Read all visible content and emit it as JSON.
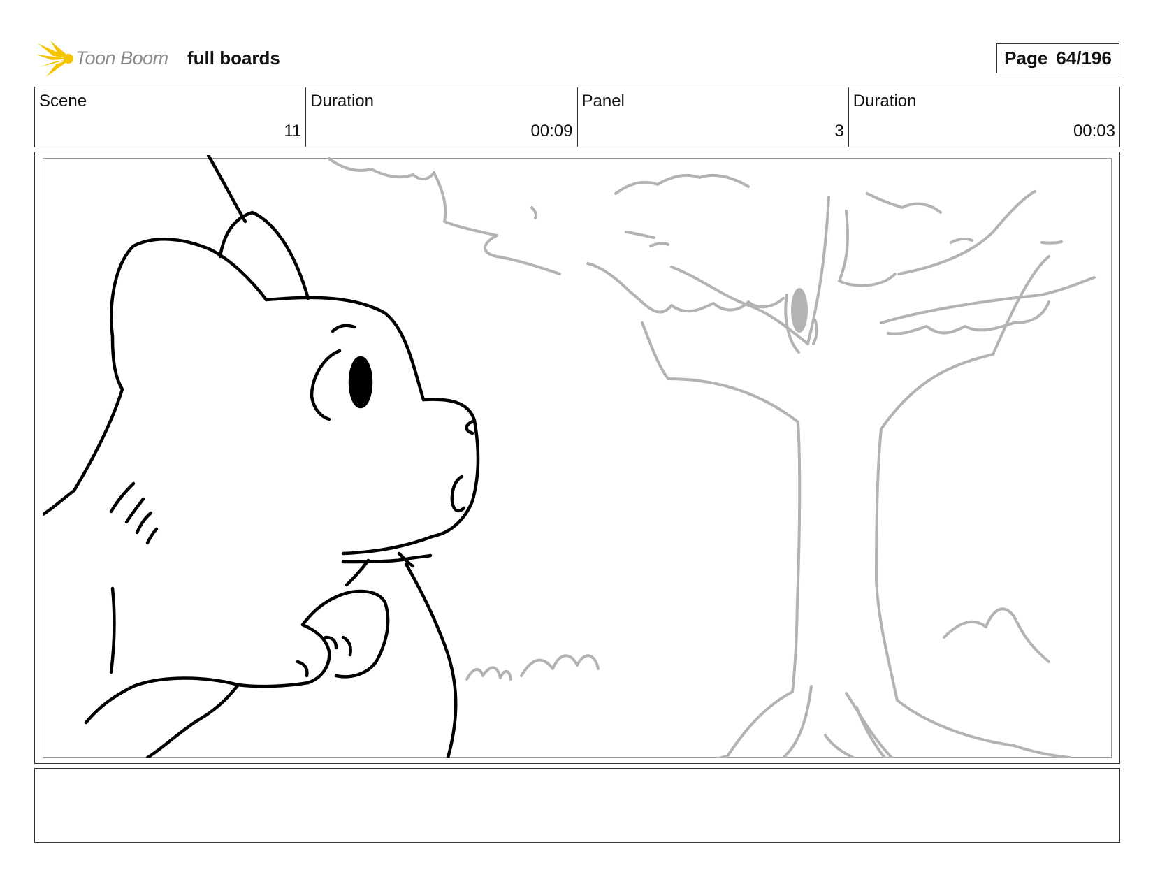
{
  "header": {
    "brand": "Toon Boom",
    "project_name": "full boards",
    "page_label": "Page",
    "page_value": "64/196"
  },
  "info": {
    "scene_label": "Scene",
    "scene_value": "11",
    "scene_duration_label": "Duration",
    "scene_duration_value": "00:09",
    "panel_label": "Panel",
    "panel_value": "3",
    "panel_duration_label": "Duration",
    "panel_duration_value": "00:03"
  },
  "colors": {
    "logo_yellow": "#f5c400",
    "sketch_black": "#000000",
    "sketch_grey": "#b3b3b3"
  },
  "notes": {
    "text": ""
  }
}
